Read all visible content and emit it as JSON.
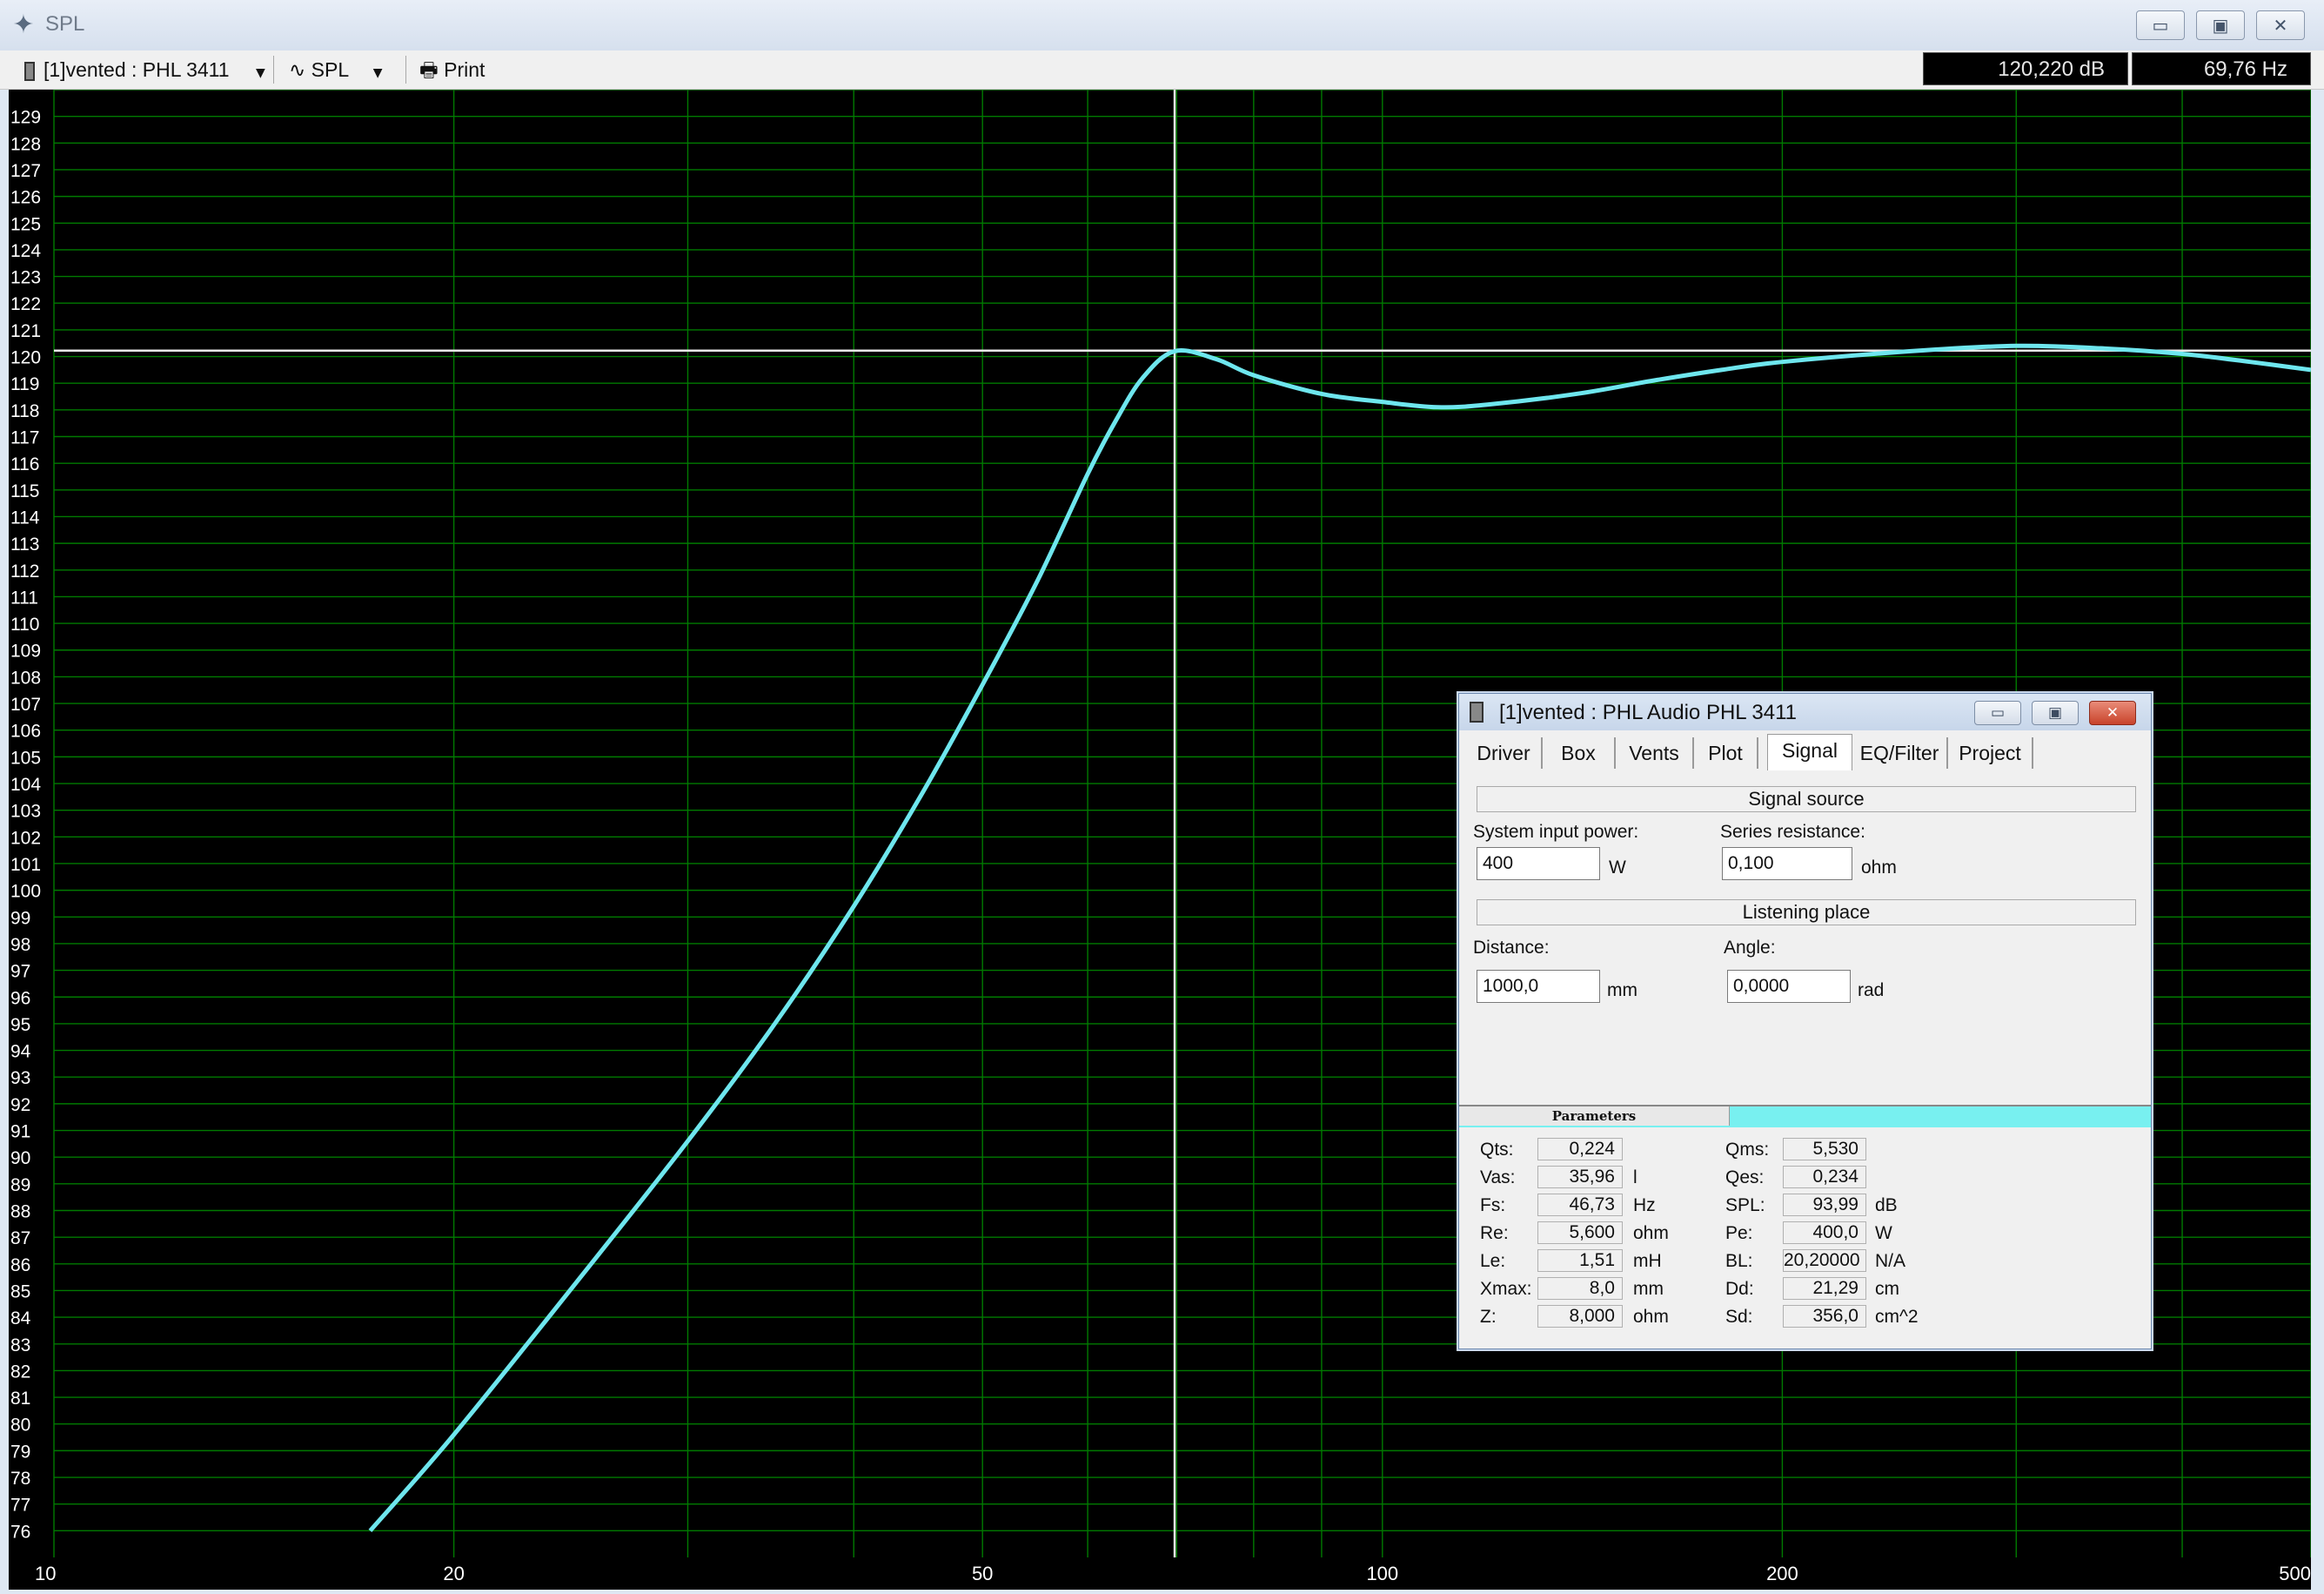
{
  "window": {
    "title": "SPL"
  },
  "toolbar": {
    "project_select": "[1]vented : PHL 3411",
    "view_select": "SPL",
    "print_label": "Print"
  },
  "readouts": {
    "level": "120,220 dB",
    "frequency": "69,76 Hz"
  },
  "chart_data": {
    "type": "line",
    "x_scale": "log",
    "xlim": [
      10,
      500
    ],
    "ylim": [
      75,
      130
    ],
    "x_tick_labels": [
      10,
      20,
      50,
      100,
      200,
      500
    ],
    "y_tick_labels": [
      76,
      77,
      78,
      79,
      80,
      81,
      82,
      83,
      84,
      85,
      86,
      87,
      88,
      89,
      90,
      91,
      92,
      93,
      94,
      95,
      96,
      97,
      98,
      99,
      100,
      101,
      102,
      103,
      104,
      105,
      106,
      107,
      108,
      109,
      110,
      111,
      112,
      113,
      114,
      115,
      116,
      117,
      118,
      119,
      120,
      121,
      122,
      123,
      124,
      125,
      126,
      127,
      128,
      129
    ],
    "grid": true,
    "cursor": {
      "x": 69.76,
      "y": 120.22
    },
    "series": [
      {
        "color": "#6ee6ee",
        "x": [
          17.3,
          20,
          25,
          30,
          35,
          40,
          45,
          50,
          55,
          60,
          63,
          66,
          69.76,
          75,
          80,
          90,
          100,
          110,
          120,
          140,
          160,
          180,
          200,
          250,
          300,
          350,
          400,
          450,
          500
        ],
        "y": [
          76,
          79.6,
          85.6,
          90.6,
          95.1,
          99.4,
          103.6,
          107.7,
          111.6,
          115.6,
          117.6,
          119.2,
          120.2,
          119.9,
          119.3,
          118.6,
          118.3,
          118.1,
          118.2,
          118.6,
          119.1,
          119.5,
          119.8,
          120.2,
          120.4,
          120.3,
          120.1,
          119.8,
          119.5
        ]
      }
    ]
  },
  "dialog": {
    "title": "[1]vented : PHL Audio PHL 3411",
    "tabs": [
      "Driver",
      "Box",
      "Vents",
      "Plot",
      "Signal",
      "EQ/Filter",
      "Project"
    ],
    "active_tab": "Signal",
    "signal_source": {
      "header": "Signal source",
      "power_label": "System input power:",
      "power_value": "400",
      "power_unit": "W",
      "resistance_label": "Series resistance:",
      "resistance_value": "0,100",
      "resistance_unit": "ohm"
    },
    "listening_place": {
      "header": "Listening place",
      "distance_label": "Distance:",
      "distance_value": "1000,0",
      "distance_unit": "mm",
      "angle_label": "Angle:",
      "angle_value": "0,0000",
      "angle_unit": "rad"
    },
    "parameters": {
      "tab_label": "Parameters",
      "left": [
        {
          "label": "Qts:",
          "value": "0,224",
          "unit": ""
        },
        {
          "label": "Vas:",
          "value": "35,96",
          "unit": "l"
        },
        {
          "label": "Fs:",
          "value": "46,73",
          "unit": "Hz"
        },
        {
          "label": "Re:",
          "value": "5,600",
          "unit": "ohm"
        },
        {
          "label": "Le:",
          "value": "1,51",
          "unit": "mH"
        },
        {
          "label": "Xmax:",
          "value": "8,0",
          "unit": "mm"
        },
        {
          "label": "Z:",
          "value": "8,000",
          "unit": "ohm"
        }
      ],
      "right": [
        {
          "label": "Qms:",
          "value": "5,530",
          "unit": ""
        },
        {
          "label": "Qes:",
          "value": "0,234",
          "unit": ""
        },
        {
          "label": "SPL:",
          "value": "93,99",
          "unit": "dB"
        },
        {
          "label": "Pe:",
          "value": "400,0",
          "unit": "W"
        },
        {
          "label": "BL:",
          "value": "20,20000",
          "unit": "N/A"
        },
        {
          "label": "Dd:",
          "value": "21,29",
          "unit": "cm"
        },
        {
          "label": "Sd:",
          "value": "356,0",
          "unit": "cm^2"
        }
      ]
    }
  }
}
